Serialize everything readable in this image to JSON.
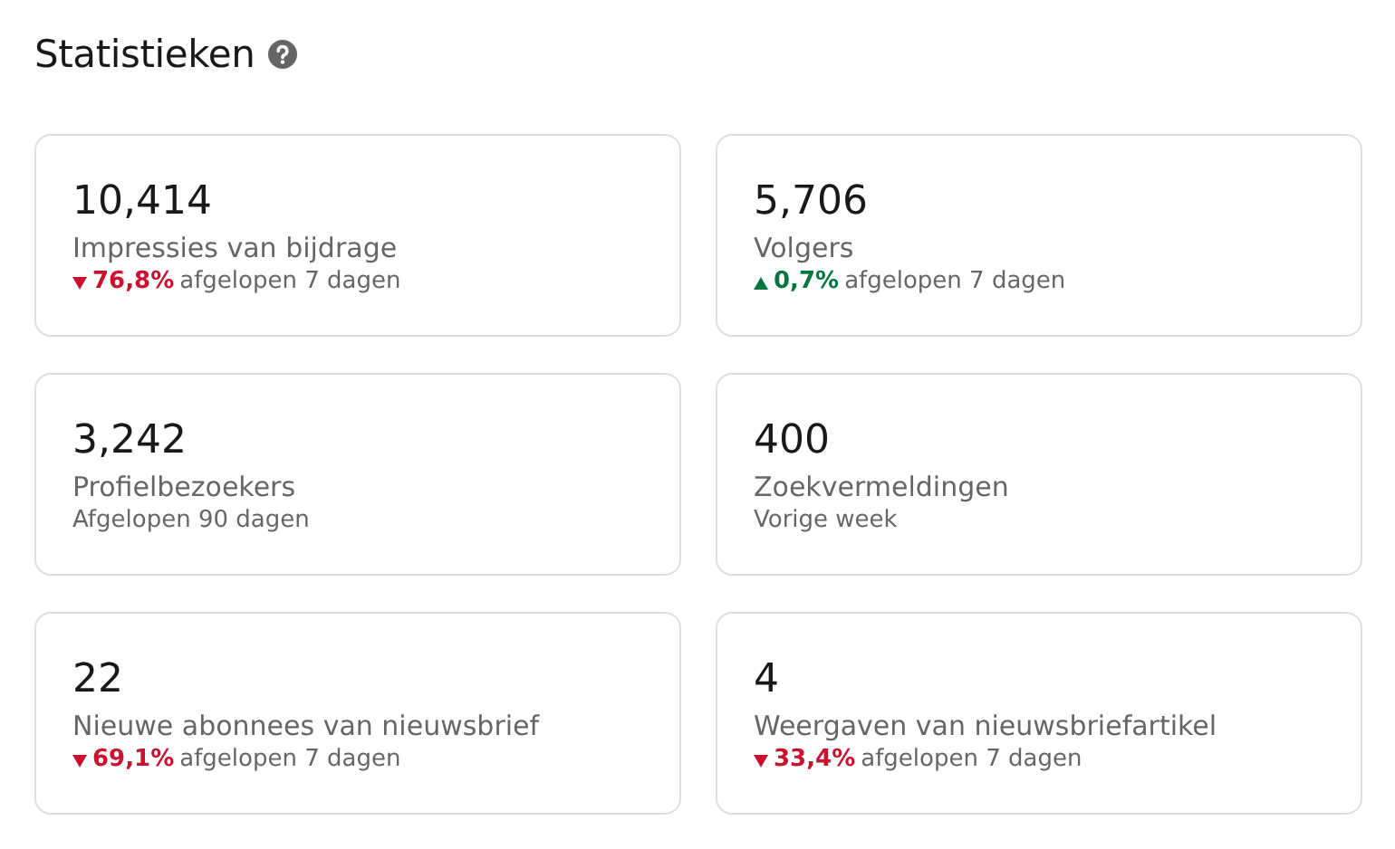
{
  "title": "Statistieken",
  "cards": [
    {
      "value": "10,414",
      "label": "Impressies van bijdrage",
      "trend": {
        "kind": "down",
        "change": "76,8%"
      },
      "period": "afgelopen 7 dagen"
    },
    {
      "value": "5,706",
      "label": "Volgers",
      "trend": {
        "kind": "up",
        "change": "0,7%"
      },
      "period": "afgelopen 7 dagen"
    },
    {
      "value": "3,242",
      "label": "Profielbezoekers",
      "period": "Afgelopen 90 dagen"
    },
    {
      "value": "400",
      "label": "Zoekvermeldingen",
      "period": "Vorige week"
    },
    {
      "value": "22",
      "label": "Nieuwe abonnees van nieuwsbrief",
      "trend": {
        "kind": "down",
        "change": "69,1%"
      },
      "period": "afgelopen 7 dagen"
    },
    {
      "value": "4",
      "label": "Weergaven van nieuwsbriefartikel",
      "trend": {
        "kind": "down",
        "change": "33,4%"
      },
      "period": "afgelopen 7 dagen"
    }
  ]
}
